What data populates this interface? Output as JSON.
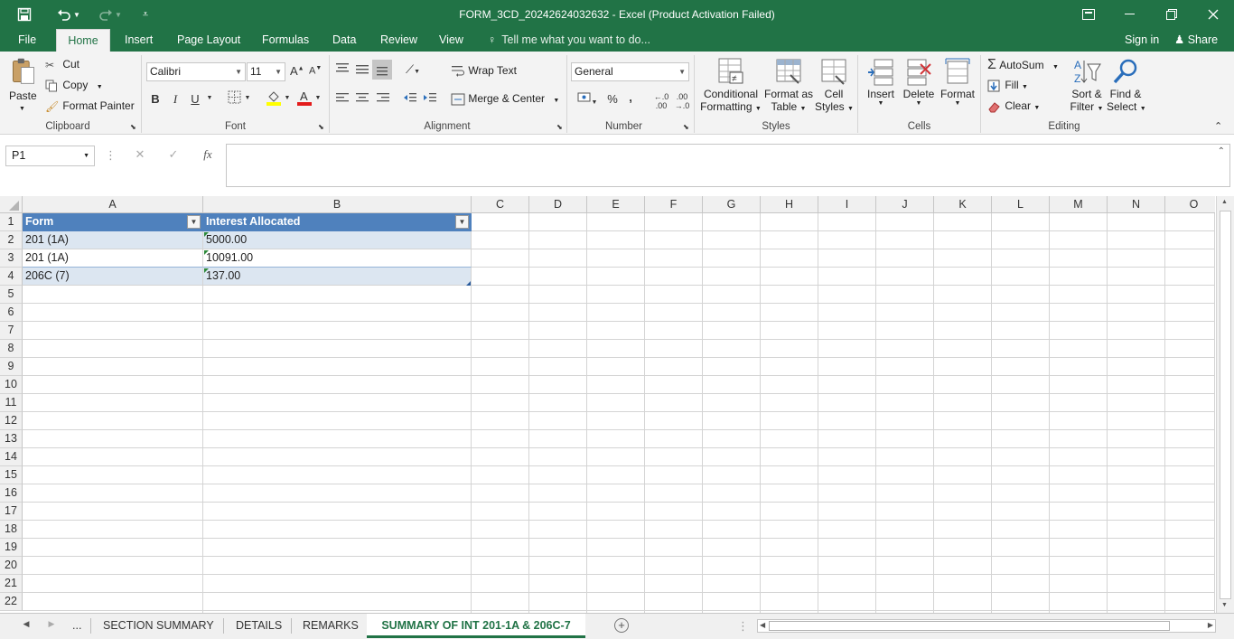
{
  "window": {
    "title": "FORM_3CD_20242624032632 - Excel (Product Activation Failed)"
  },
  "tabs": [
    {
      "label": "File"
    },
    {
      "label": "Home"
    },
    {
      "label": "Insert"
    },
    {
      "label": "Page Layout"
    },
    {
      "label": "Formulas"
    },
    {
      "label": "Data"
    },
    {
      "label": "Review"
    },
    {
      "label": "View"
    }
  ],
  "tell_me": "Tell me what you want to do...",
  "account": {
    "sign_in": "Sign in",
    "share": "Share"
  },
  "ribbon": {
    "clipboard": {
      "paste": "Paste",
      "cut": "Cut",
      "copy": "Copy",
      "format_painter": "Format Painter",
      "label": "Clipboard"
    },
    "font": {
      "name": "Calibri",
      "size": "11",
      "bold": "B",
      "italic": "I",
      "underline": "U",
      "label": "Font"
    },
    "alignment": {
      "wrap_text": "Wrap Text",
      "merge_center": "Merge & Center",
      "label": "Alignment"
    },
    "number": {
      "format": "General",
      "percent": "%",
      "comma": ",",
      "label": "Number"
    },
    "styles": {
      "conditional": "Conditional",
      "conditional2": "Formatting",
      "format_as": "Format as",
      "format_as2": "Table",
      "cell": "Cell",
      "cell2": "Styles",
      "label": "Styles"
    },
    "cells": {
      "insert": "Insert",
      "delete": "Delete",
      "format": "Format",
      "label": "Cells"
    },
    "editing": {
      "autosum": "AutoSum",
      "fill": "Fill",
      "clear": "Clear",
      "sort": "Sort &",
      "sort2": "Filter",
      "find": "Find &",
      "find2": "Select",
      "label": "Editing"
    }
  },
  "formula_bar": {
    "name_box": "P1",
    "fx": "fx",
    "value": ""
  },
  "columns": [
    "A",
    "B",
    "C",
    "D",
    "E",
    "F",
    "G",
    "H",
    "I",
    "J",
    "K",
    "L",
    "M",
    "N",
    "O"
  ],
  "rows": [
    "1",
    "2",
    "3",
    "4",
    "5",
    "6",
    "7",
    "8",
    "9",
    "10",
    "11",
    "12",
    "13",
    "14",
    "15",
    "16",
    "17",
    "18",
    "19",
    "20",
    "21",
    "22"
  ],
  "table": {
    "headers": [
      "Form",
      "Interest Allocated"
    ],
    "data": [
      [
        "201 (1A)",
        "5000.00"
      ],
      [
        "201 (1A)",
        "10091.00"
      ],
      [
        "206C (7)",
        "137.00"
      ]
    ]
  },
  "sheets": {
    "ellipsis": "...",
    "tabs": [
      "SECTION SUMMARY",
      "DETAILS",
      "REMARKS",
      "SUMMARY OF INT 201-1A & 206C-7"
    ]
  },
  "colors": {
    "excel_green": "#217346",
    "table_header": "#4f81bd",
    "band": "#dce6f1"
  }
}
